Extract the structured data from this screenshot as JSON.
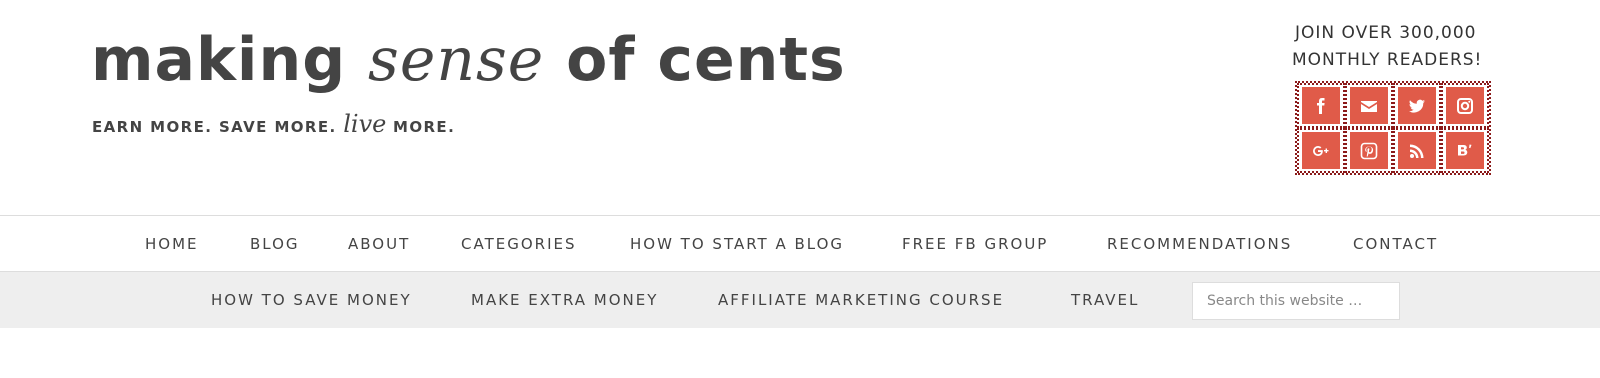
{
  "logo": {
    "part1": "making ",
    "part2": "sense",
    "part3": " of cents",
    "tag1": "EARN MORE. SAVE MORE. ",
    "tag2": "live",
    "tag3": " MORE."
  },
  "social": {
    "line1": "JOIN OVER 300,000",
    "line2": "MONTHLY READERS!",
    "icon_color": "#e05b49",
    "icons": [
      "facebook-icon",
      "email-icon",
      "twitter-icon",
      "instagram-icon",
      "google-plus-icon",
      "pinterest-icon",
      "rss-icon",
      "bloglovin-icon"
    ]
  },
  "nav_primary": [
    "HOME",
    "BLOG",
    "ABOUT",
    "CATEGORIES",
    "HOW TO START A BLOG",
    "FREE FB GROUP",
    "RECOMMENDATIONS",
    "CONTACT"
  ],
  "nav_secondary": [
    "HOW TO SAVE MONEY",
    "MAKE EXTRA MONEY",
    "AFFILIATE MARKETING COURSE",
    "TRAVEL"
  ],
  "search": {
    "placeholder": "Search this website …"
  }
}
